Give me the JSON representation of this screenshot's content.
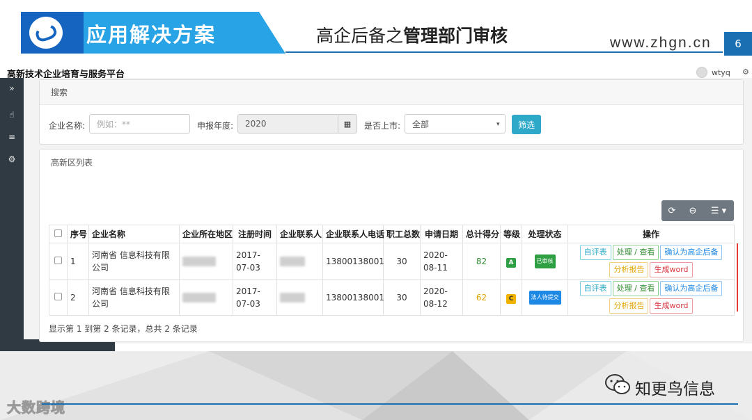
{
  "slide": {
    "banner_title": "应用解决方案",
    "title_plain": "高企后备之",
    "title_bold": "管理部门审核",
    "site_url": "www.zhgn.cn",
    "page_number": "6",
    "watermark": "大数跨境",
    "wechat_name": "知更鸟信息",
    "colors": {
      "accent_blue": "#27a3e6",
      "dark_blue": "#1565c0",
      "line_blue": "#1a6fb3"
    }
  },
  "app": {
    "title": "高新技术企业培育与服务平台",
    "user": "wtyq",
    "sidebar_icons": [
      "expand-icon",
      "hand-pointer-icon",
      "menu-icon",
      "cogs-icon"
    ],
    "search_panel": {
      "heading": "搜索",
      "company_label": "企业名称:",
      "company_placeholder": "例如：**",
      "year_label": "申报年度:",
      "year_value": "2020",
      "listed_label": "是否上市:",
      "listed_value": "全部",
      "filter_button": "筛选"
    },
    "list_panel": {
      "heading": "高新区列表",
      "columns": [
        "序号",
        "企业名称",
        "企业所在地区",
        "注册时间",
        "企业联系人",
        "企业联系人电话",
        "职工总数",
        "申请日期",
        "总计得分",
        "等级",
        "处理状态",
        "操作"
      ],
      "rows": [
        {
          "index": "1",
          "company": "河南省          信息科技有限公司",
          "reg_date": "2017-07-03",
          "phone": "13800138001",
          "staff": "30",
          "apply_date": "2020-08-11",
          "score": "82",
          "grade": "A",
          "status": "已审核"
        },
        {
          "index": "2",
          "company": "河南省          信息科技有限公司",
          "reg_date": "2017-07-03",
          "phone": "13800138001",
          "staff": "30",
          "apply_date": "2020-08-12",
          "score": "62",
          "grade": "C",
          "status": "法人待提交"
        }
      ],
      "actions": {
        "evaluate": "自评表",
        "process": "处理 / 查看",
        "confirm": "确认为高企后备",
        "report": "分析报告",
        "word": "生成word"
      },
      "footer": "显示第 1 到第 2 条记录，总共 2 条记录"
    }
  }
}
